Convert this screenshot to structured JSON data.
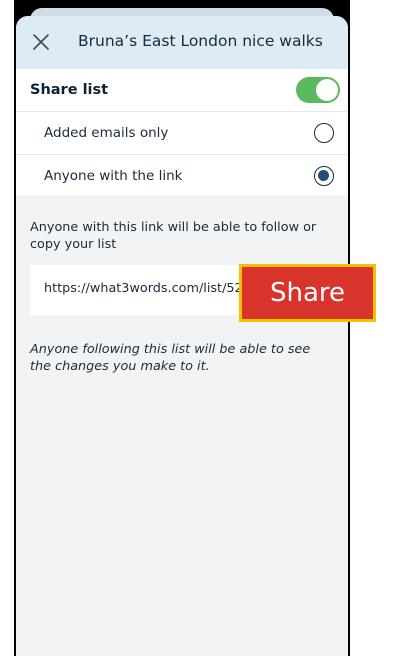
{
  "header": {
    "title": "Bruna’s East London nice walks",
    "close_icon": "close-icon"
  },
  "share_list": {
    "label": "Share list",
    "enabled": true,
    "toggle_color": "#5cb85c"
  },
  "options": [
    {
      "label": "Added emails only",
      "selected": false
    },
    {
      "label": "Anyone with the link",
      "selected": true
    }
  ],
  "info_text": "Anyone with this link will be able to follow or copy your list",
  "link": {
    "url": "https://what3words.com/list/52…",
    "share_label": "Share",
    "share_color": "#d9342b",
    "highlight_color": "#f2c200"
  },
  "note_text": "Anyone following this list will be able to see the changes you make to it."
}
